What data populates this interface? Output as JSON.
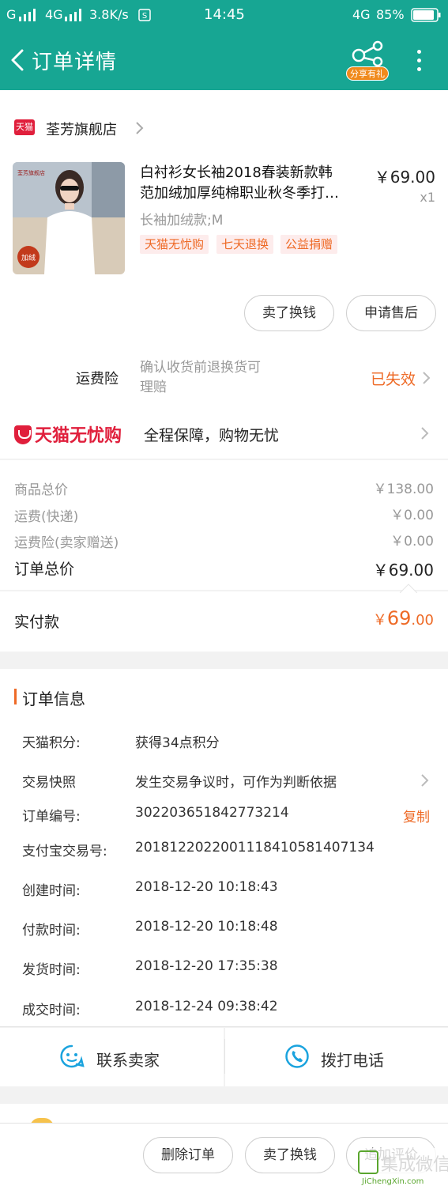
{
  "status_bar": {
    "signal_left": "G",
    "network": "4G",
    "speed": "3.8K/s",
    "time": "14:45",
    "network_right": "4G",
    "battery": "85%"
  },
  "header": {
    "title": "订单详情",
    "share_badge": "分享有礼"
  },
  "shop": {
    "logo_text": "天猫",
    "name": "荃芳旗舰店"
  },
  "product": {
    "title_line1": "白衬衫女长袖2018春装新款韩",
    "title_line2": "范加绒加厚纯棉职业秋冬季打…",
    "price": "￥69.00",
    "quantity": "x1",
    "sku": "长袖加绒款;M",
    "tags": [
      "天猫无忧购",
      "七天退换",
      "公益捐赠"
    ],
    "image_brand": "荃芳旗舰店",
    "image_badge": "加绒"
  },
  "item_actions": {
    "sell_label": "卖了换钱",
    "after_sale_label": "申请售后"
  },
  "insurance": {
    "label": "运费险",
    "desc_line1": "确认收货前退换货可",
    "desc_line2": "理赔",
    "status": "已失效"
  },
  "wuyou": {
    "logo_text": "天猫无忧购",
    "desc": "全程保障，购物无忧"
  },
  "prices": {
    "goods_label": "商品总价",
    "goods_value": "￥138.00",
    "shipping_label": "运费(快递)",
    "shipping_value": "￥0.00",
    "ins_label": "运费险(卖家赠送)",
    "ins_value": "￥0.00",
    "total_label": "订单总价",
    "total_value": "￥69.00",
    "paid_label": "实付款",
    "paid_symbol": "￥",
    "paid_int": "69",
    "paid_dec": ".00"
  },
  "order_info": {
    "title": "订单信息",
    "rows": [
      {
        "key": "天猫积分:",
        "value": "获得34点积分"
      },
      {
        "key": "交易快照",
        "value": "发生交易争议时，可作为判断依据"
      },
      {
        "key": "订单编号:",
        "value": "302203651842773214"
      },
      {
        "key": "支付宝交易号:",
        "value": "2018122022001118410581407134"
      },
      {
        "key": "创建时间:",
        "value": "2018-12-20 10:18:43"
      },
      {
        "key": "付款时间:",
        "value": "2018-12-20 10:18:48"
      },
      {
        "key": "发货时间:",
        "value": "2018-12-20 17:35:38"
      },
      {
        "key": "成交时间:",
        "value": "2018-12-24 09:38:42"
      }
    ],
    "copy_label": "复制"
  },
  "contact": {
    "seller_label": "联系卖家",
    "call_label": "拨打电话"
  },
  "bottom_bar": {
    "delete_label": "删除订单",
    "sell_label": "卖了换钱",
    "review_label": "追加评价"
  },
  "watermark": {
    "brand": "集成微信",
    "url": "JiChengXin.com"
  },
  "colors": {
    "header": "#17a693",
    "accent": "#ee6a26",
    "tmall_red": "#e01f3c",
    "contact_icon": "#1aa3de"
  }
}
